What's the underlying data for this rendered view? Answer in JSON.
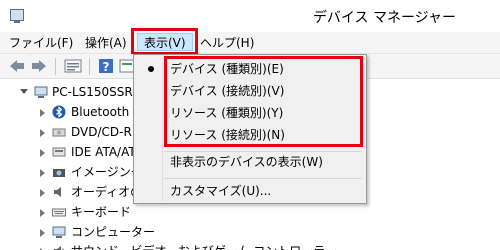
{
  "window": {
    "title": "デバイス マネージャー"
  },
  "menubar": {
    "items": [
      {
        "label": "ファイル(F)"
      },
      {
        "label": "操作(A)"
      },
      {
        "label": "表示(V)"
      },
      {
        "label": "ヘルプ(H)"
      }
    ],
    "active_index": 2
  },
  "toolbar": {
    "buttons": [
      "back-arrow-icon",
      "forward-arrow-icon",
      "properties-icon",
      "help-icon",
      "update-icon"
    ]
  },
  "tree": {
    "root": "PC-LS150SSR",
    "items": [
      {
        "label": "Bluetooth",
        "icon": "bluetooth-icon"
      },
      {
        "label": "DVD/CD-R",
        "icon": "dvd-drive-icon"
      },
      {
        "label": "IDE ATA/AT",
        "icon": "ide-controller-icon"
      },
      {
        "label": "イメージング ラ",
        "icon": "camera-icon"
      },
      {
        "label": "オーディオの入",
        "icon": "speaker-icon"
      },
      {
        "label": "キーボード",
        "icon": "keyboard-icon"
      },
      {
        "label": "コンピューター",
        "icon": "computer-icon"
      },
      {
        "label": "サウンド、ビデオ、およびゲーム コントローラー",
        "icon": "sound-icon"
      }
    ]
  },
  "view_menu": {
    "items": [
      {
        "label": "デバイス (種類別)(E)",
        "checked": true
      },
      {
        "label": "デバイス (接続別)(V)",
        "checked": false
      },
      {
        "label": "リソース (種類別)(Y)",
        "checked": false
      },
      {
        "label": "リソース (接続別)(N)",
        "checked": false
      },
      {
        "label": "非表示のデバイスの表示(W)",
        "checked": false
      },
      {
        "label": "カスタマイズ(U)...",
        "checked": false
      }
    ]
  },
  "colors": {
    "highlight_border": "#e50012",
    "menu_active_bg": "#cce8ff"
  }
}
